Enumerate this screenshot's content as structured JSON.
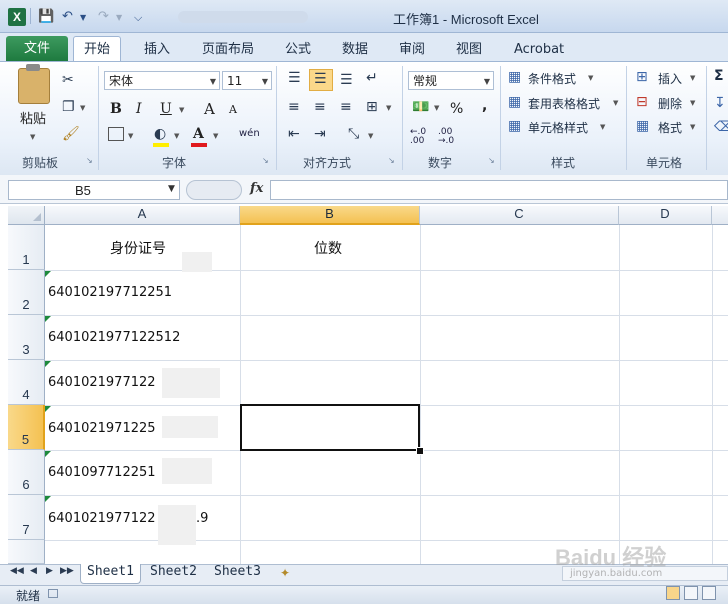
{
  "window": {
    "title": "工作簿1 - Microsoft Excel",
    "app_icon": "X"
  },
  "qat": [
    "save-icon",
    "undo-icon",
    "redo-icon",
    "customize-icon"
  ],
  "tabs": [
    "文件",
    "开始",
    "插入",
    "页面布局",
    "公式",
    "数据",
    "审阅",
    "视图",
    "Acrobat"
  ],
  "ribbon": {
    "clipboard": {
      "paste": "粘贴",
      "label": "剪贴板"
    },
    "font": {
      "name": "宋体",
      "size": "11",
      "label": "字体",
      "bold": "B",
      "italic": "I",
      "underline": "U",
      "grow": "A",
      "shrink": "A",
      "wen": "wén"
    },
    "alignment": {
      "label": "对齐方式"
    },
    "number": {
      "format": "常规",
      "label": "数字",
      "percent": "%",
      "comma": ",",
      "inc": "←.0 .00",
      "dec": ".00 →.0"
    },
    "styles": {
      "cond": "条件格式",
      "table": "套用表格格式",
      "cell": "单元格样式",
      "label": "样式"
    },
    "cells": {
      "insert": "插入",
      "delete": "删除",
      "format": "格式",
      "label": "单元格"
    },
    "sigma": "Σ"
  },
  "formula_bar": {
    "name_box": "B5",
    "fx": "fx",
    "value": ""
  },
  "columns": [
    "A",
    "B",
    "C",
    "D"
  ],
  "rows": [
    "1",
    "2",
    "3",
    "4",
    "5",
    "6",
    "7"
  ],
  "cells": {
    "A1": "身份证号",
    "B1": "位数",
    "A2": "640102197712251",
    "A3": "6401021977122512",
    "A4": "6401021977122",
    "A5": "6401021971225",
    "A6": "6401097712251",
    "A7": "6401021977122",
    "A7_tail": ".9"
  },
  "active_cell": "B5",
  "sheet_tabs": [
    "Sheet1",
    "Sheet2",
    "Sheet3"
  ],
  "active_sheet": "Sheet1",
  "status": {
    "ready": "就绪"
  },
  "watermark": {
    "brand": "Baidu 经验",
    "url": "jingyan.baidu.com"
  },
  "colors": {
    "file_tab": "#1e7a3f",
    "selection": "#f4c152",
    "excel": "#1f7244"
  }
}
